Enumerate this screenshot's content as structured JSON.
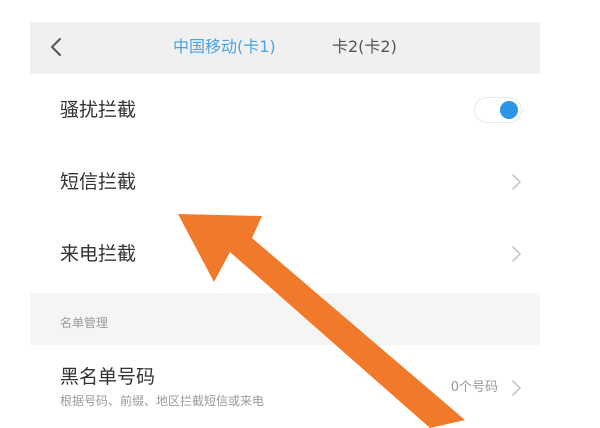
{
  "header": {
    "tabs": [
      {
        "label": "中国移动(卡1)",
        "selected": true
      },
      {
        "label": "卡2(卡2)",
        "selected": false
      }
    ]
  },
  "settings": {
    "harassment_block": {
      "label": "骚扰拦截",
      "enabled": true
    },
    "sms_block": {
      "label": "短信拦截"
    },
    "call_block": {
      "label": "来电拦截"
    }
  },
  "list_management": {
    "section_title": "名单管理",
    "blacklist": {
      "label": "黑名单号码",
      "description": "根据号码、前缀、地区拦截短信或来电",
      "count_label": "0个号码"
    }
  },
  "colors": {
    "accent": "#2b96e8",
    "tab_selected": "#4aa3e6",
    "annotation_arrow": "#f07a2a"
  },
  "icons": {
    "back": "back-arrow-icon",
    "chevron": "chevron-right-icon",
    "annotation": "orange-pointer-arrow"
  }
}
